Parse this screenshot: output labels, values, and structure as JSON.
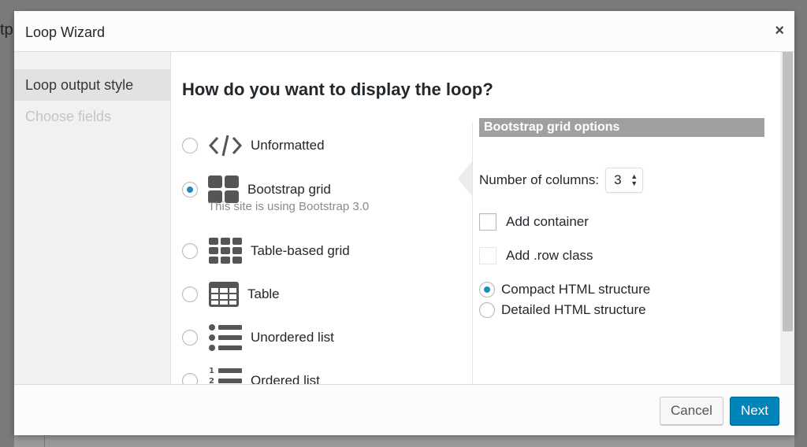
{
  "background": {
    "partial_text": "tp"
  },
  "dialog": {
    "title": "Loop Wizard",
    "close_symbol": "×"
  },
  "sidebar": {
    "items": [
      {
        "label": "Loop output style",
        "state": "active"
      },
      {
        "label": "Choose fields",
        "state": "disabled"
      }
    ]
  },
  "main": {
    "question": "How do you want to display the loop?",
    "options": [
      {
        "label": "Unformatted",
        "icon": "code-icon",
        "selected": false
      },
      {
        "label": "Bootstrap grid",
        "icon": "bootstrap-grid-icon",
        "selected": true,
        "note": "This site is using Bootstrap 3.0"
      },
      {
        "label": "Table-based grid",
        "icon": "table-grid-icon",
        "selected": false
      },
      {
        "label": "Table",
        "icon": "table-icon",
        "selected": false
      },
      {
        "label": "Unordered list",
        "icon": "unordered-list-icon",
        "selected": false
      },
      {
        "label": "Ordered list",
        "icon": "ordered-list-icon",
        "selected": false
      }
    ]
  },
  "options_panel": {
    "heading": "Bootstrap grid options",
    "columns_label": "Number of columns:",
    "columns_value": "3",
    "add_container_label": "Add container",
    "add_container_checked": false,
    "add_row_label": "Add .row class",
    "add_row_disabled": true,
    "structure": [
      {
        "label": "Compact HTML structure",
        "selected": true
      },
      {
        "label": "Detailed HTML structure",
        "selected": false
      }
    ]
  },
  "footer": {
    "cancel_label": "Cancel",
    "next_label": "Next"
  },
  "colors": {
    "primary": "#0085ba",
    "radio_dot": "#1e8cbe",
    "panel_heading_bg": "#a0a0a0",
    "icon": "#555555"
  }
}
